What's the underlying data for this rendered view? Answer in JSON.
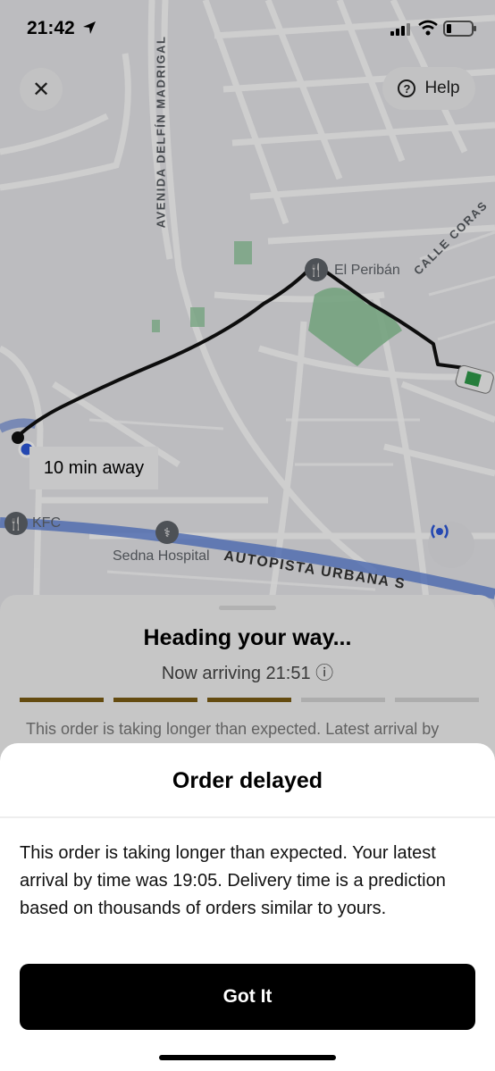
{
  "status_bar": {
    "time": "21:42"
  },
  "map": {
    "street_labels": {
      "avenida": "AVENIDA DELFÍN MADRIGAL",
      "calle": "CALLE CORAS",
      "autopista": "AUTOPISTA URBANA S"
    },
    "pois": {
      "restaurant": "El Peribán",
      "kfc": "KFC",
      "hospital": "Sedna Hospital"
    },
    "eta_label": "10 min away"
  },
  "top_actions": {
    "help_label": "Help"
  },
  "tracking_sheet": {
    "heading": "Heading your way...",
    "arriving": "Now arriving 21:51 ⓘ",
    "progress_segments": [
      {
        "done": true
      },
      {
        "done": true
      },
      {
        "done": true
      },
      {
        "done": false
      },
      {
        "done": false
      }
    ],
    "note": "This order is taking longer than expected. Latest arrival by"
  },
  "modal": {
    "title": "Order delayed",
    "body": "This order is taking longer than expected. Your latest arrival by time was 19:05. Delivery time is a prediction based on thousands of orders similar to yours.",
    "button_label": "Got It"
  },
  "colors": {
    "progress_done": "#7a5c14",
    "route": "#111111",
    "park": "#8fc79b",
    "highway": "#5b7fd6"
  }
}
